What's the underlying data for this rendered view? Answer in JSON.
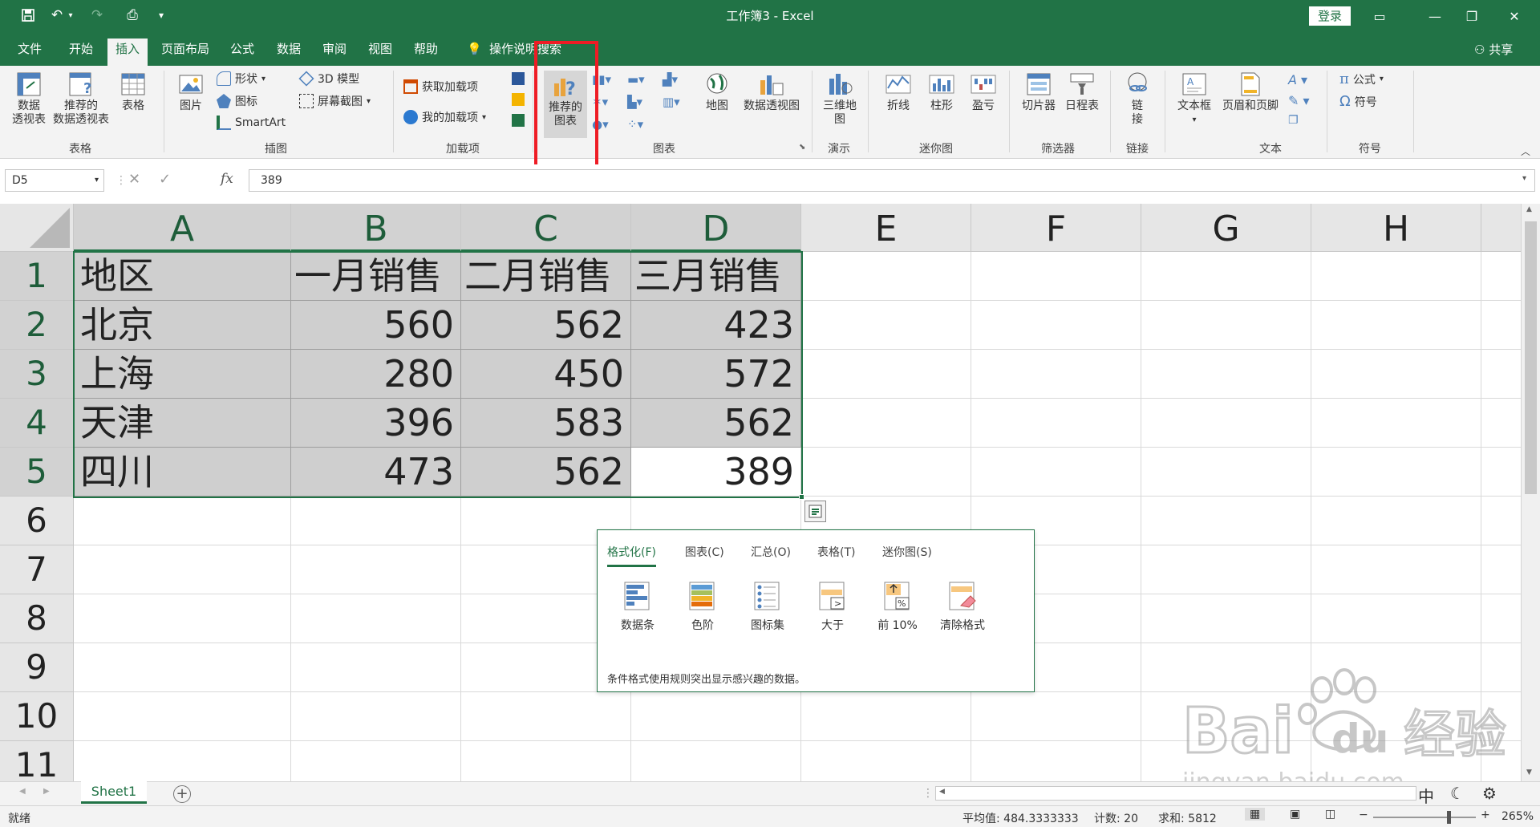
{
  "app": {
    "title": "工作簿3  -  Excel",
    "login_label": "登录",
    "share_label": "共享",
    "tell_me": "操作说明搜索"
  },
  "tabs": [
    "文件",
    "开始",
    "插入",
    "页面布局",
    "公式",
    "数据",
    "审阅",
    "视图",
    "帮助"
  ],
  "active_tab": "插入",
  "ribbon": {
    "tables": {
      "pivot": "数据\n透视表",
      "rec_pivot": "推荐的\n数据透视表",
      "table": "表格",
      "label": "表格"
    },
    "illustrations": {
      "picture": "图片",
      "shapes": "形状",
      "icons": "图标",
      "smartart": "SmartArt",
      "model3d": "3D 模型",
      "screenshot": "屏幕截图",
      "label": "插图"
    },
    "addins": {
      "get": "获取加载项",
      "mine": "我的加载项",
      "label": "加载项"
    },
    "charts": {
      "recommended": "推荐的\n图表",
      "map": "地图",
      "pivotchart": "数据透视图",
      "label": "图表"
    },
    "tours": {
      "map3d": "三维地\n图",
      "label": "演示"
    },
    "sparklines": {
      "line": "折线",
      "column": "柱形",
      "winloss": "盈亏",
      "label": "迷你图"
    },
    "filters": {
      "slicer": "切片器",
      "timeline": "日程表",
      "label": "筛选器"
    },
    "links": {
      "link": "链\n接",
      "label": "链接"
    },
    "text": {
      "textbox": "文本框",
      "headerfooter": "页眉和页脚",
      "label": "文本"
    },
    "symbols": {
      "equation": "公式",
      "symbol": "符号",
      "label": "符号"
    }
  },
  "formula_bar": {
    "name_box": "D5",
    "fx": "fx",
    "value": "389"
  },
  "columns": [
    "A",
    "B",
    "C",
    "D",
    "E",
    "F",
    "G",
    "H"
  ],
  "rows": [
    "1",
    "2",
    "3",
    "4",
    "5",
    "6",
    "7",
    "8",
    "9",
    "10",
    "11"
  ],
  "table": {
    "header": [
      "地区",
      "一月销售",
      "二月销售",
      "三月销售"
    ],
    "rows": [
      [
        "北京",
        "560",
        "562",
        "423"
      ],
      [
        "上海",
        "280",
        "450",
        "572"
      ],
      [
        "天津",
        "396",
        "583",
        "562"
      ],
      [
        "四川",
        "473",
        "562",
        "389"
      ]
    ]
  },
  "quick_analysis": {
    "tabs": [
      "格式化(F)",
      "图表(C)",
      "汇总(O)",
      "表格(T)",
      "迷你图(S)"
    ],
    "items": [
      "数据条",
      "色阶",
      "图标集",
      "大于",
      "前 10%",
      "清除格式"
    ],
    "description": "条件格式使用规则突出显示感兴趣的数据。"
  },
  "sheets": [
    "Sheet1"
  ],
  "status": {
    "ready": "就绪",
    "average": "平均值: 484.3333333",
    "count": "计数: 20",
    "sum": "求和: 5812",
    "zoom": "265%"
  },
  "watermark": {
    "text": "Bai du 经验",
    "url": "jingyan.baidu.com"
  },
  "colors": {
    "accent": "#217346",
    "highlight": "#cfcfcf",
    "annotation": "#ee1c25"
  }
}
